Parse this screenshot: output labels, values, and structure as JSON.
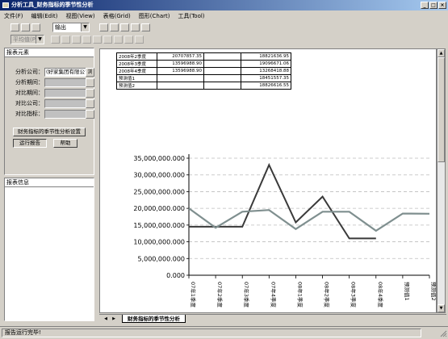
{
  "window": {
    "title": "分析工具_财务指标的季节性分析"
  },
  "menu": [
    {
      "label": "文件(F)"
    },
    {
      "label": "编辑(Edit)"
    },
    {
      "label": "视图(View)"
    },
    {
      "label": "表格(Grid)"
    },
    {
      "label": "图形(Chart)"
    },
    {
      "label": "工具(Tool)"
    }
  ],
  "toolbar": {
    "output_combo": "输出",
    "disabled_combo": "平均值(P)"
  },
  "left_panel": {
    "title": "报表元素",
    "fields": [
      {
        "label": "分析公司：",
        "value": "(好家集团有限公司",
        "suffix": "浏"
      },
      {
        "label": "分析期间：",
        "value": "",
        "suffix": ""
      },
      {
        "label": "对比期间：",
        "value": "",
        "suffix": ""
      },
      {
        "label": "对比公司：",
        "value": "",
        "suffix": ""
      },
      {
        "label": "对比指标：",
        "value": "",
        "suffix": ""
      }
    ],
    "settings_button": "财务指标的季节性分析设置",
    "run_button": "运行报告",
    "help_button": "帮助"
  },
  "info_panel": {
    "title": "报表信息"
  },
  "table": {
    "rows": [
      [
        "2008年2季度",
        "20707857.35",
        "",
        "18821636.95"
      ],
      [
        "2008年3季度",
        "13596988.90",
        "",
        "19096671.06"
      ],
      [
        "2008年4季度",
        "13596988.90",
        "",
        "13268418.88"
      ],
      [
        "预测值1",
        "",
        "",
        "18451557.35"
      ],
      [
        "预测值2",
        "",
        "",
        "18826616.55"
      ]
    ]
  },
  "sheet_tab": "财务指标的季节性分析",
  "status": {
    "text": "报告运行完毕!"
  },
  "chart_data": {
    "type": "line",
    "categories": [
      "07年1季度",
      "07年2季度",
      "07年3季度",
      "07年4季度",
      "08年1季度",
      "08年2季度",
      "08年3季度",
      "08年4季度",
      "预测值1",
      "预测值2"
    ],
    "series": [
      {
        "values": [
          14500000,
          14500000,
          14500000,
          33000000,
          15800000,
          23500000,
          11000000,
          11000000,
          null,
          null
        ]
      },
      {
        "values": [
          20000000,
          14200000,
          19000000,
          19500000,
          13800000,
          19000000,
          19000000,
          13300000,
          18450000,
          18400000
        ]
      }
    ],
    "colors": [
      "#3a3a3a",
      "#7f8f8f"
    ],
    "ylim": [
      0,
      35000000
    ],
    "yticks": [
      "0.000",
      "5,000,000.000",
      "10,000,000.000",
      "15,000,000.000",
      "20,000,000.000",
      "25,000,000.000",
      "30,000,000.000",
      "35,000,000.000"
    ],
    "ytick_values": [
      0,
      5000000,
      10000000,
      15000000,
      20000000,
      25000000,
      30000000,
      35000000
    ],
    "grid": true
  }
}
